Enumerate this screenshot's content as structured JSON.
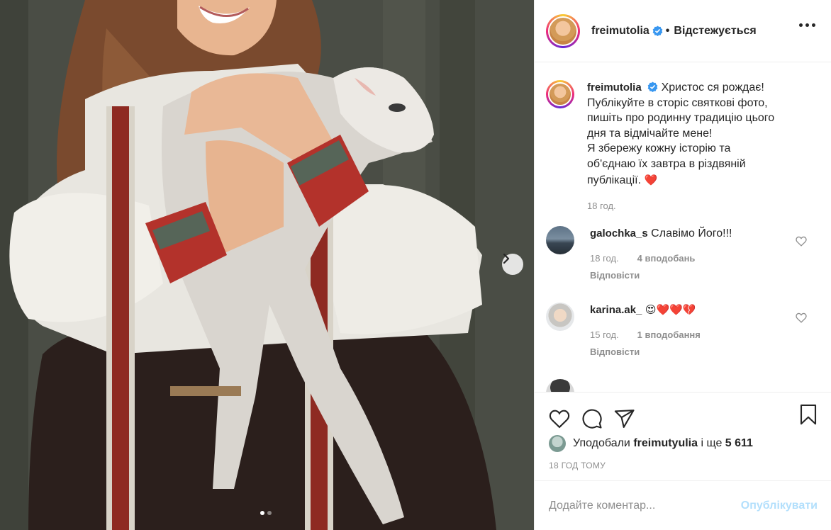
{
  "post": {
    "username": "freimutolia",
    "follow_state": "Відстежується",
    "separator": "•",
    "caption": "Христос ся рождає!\nПублікуйте в сторіс святкові фото,\nпишіть про родинну традицію цього\nдня та відмічайте мене!\nЯ збережу кожну історію та\nоб'єднаю їх завтра в різдвяній\nпублікації.",
    "caption_emoji": "❤️",
    "caption_time": "18 год."
  },
  "comments": [
    {
      "username": "galochka_s",
      "text": "Славімо Його!!!",
      "time": "18 год.",
      "likes": "4 вподобань",
      "reply": "Відповісти"
    },
    {
      "username": "karina.ak_",
      "text": "😍❤️❤️💔",
      "time": "15 год.",
      "likes": "1 вподобання",
      "reply": "Відповісти"
    }
  ],
  "likes": {
    "prefix": "Уподобали",
    "user": "freimutyulia",
    "connector": "і ще",
    "count": "5 611"
  },
  "timestamp": "18 ГОД ТОМУ",
  "comment_box": {
    "placeholder": "Додайте коментар...",
    "post_label": "Опублікувати"
  },
  "carousel": {
    "current": 1,
    "total": 2
  },
  "colors": {
    "verified": "#3897f0",
    "post_button_disabled": "#b2dffc",
    "meta_text": "#8e8e8e",
    "text": "#262626"
  },
  "icons": [
    "verified-badge-icon",
    "more-options-icon",
    "like-icon",
    "comment-icon",
    "share-icon",
    "bookmark-icon",
    "comment-like-icon",
    "carousel-next-icon"
  ]
}
